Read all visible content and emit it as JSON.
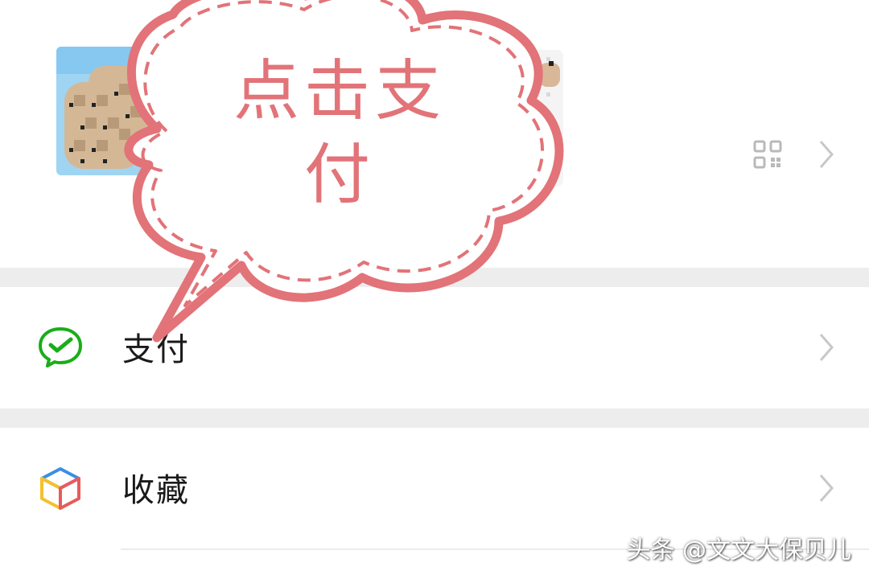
{
  "profile": {
    "avatar_icon": "mosaic-avatar",
    "qr_icon": "qr-code-icon",
    "chevron_icon": "chevron-right-icon"
  },
  "menu": {
    "items": [
      {
        "label": "支付",
        "icon": "wechat-pay-icon",
        "icon_color": "#1aad19"
      },
      {
        "label": "收藏",
        "icon": "favorites-cube-icon",
        "icon_colors": [
          "#e85b5b",
          "#f5c02e",
          "#3a8ee6"
        ]
      }
    ]
  },
  "overlay": {
    "callout_text": "点击支付",
    "color": "#e27378"
  },
  "watermark": {
    "text": "头条 @文文大保贝儿"
  },
  "colors": {
    "separator": "#ededed",
    "chevron": "#c8c8c8"
  }
}
